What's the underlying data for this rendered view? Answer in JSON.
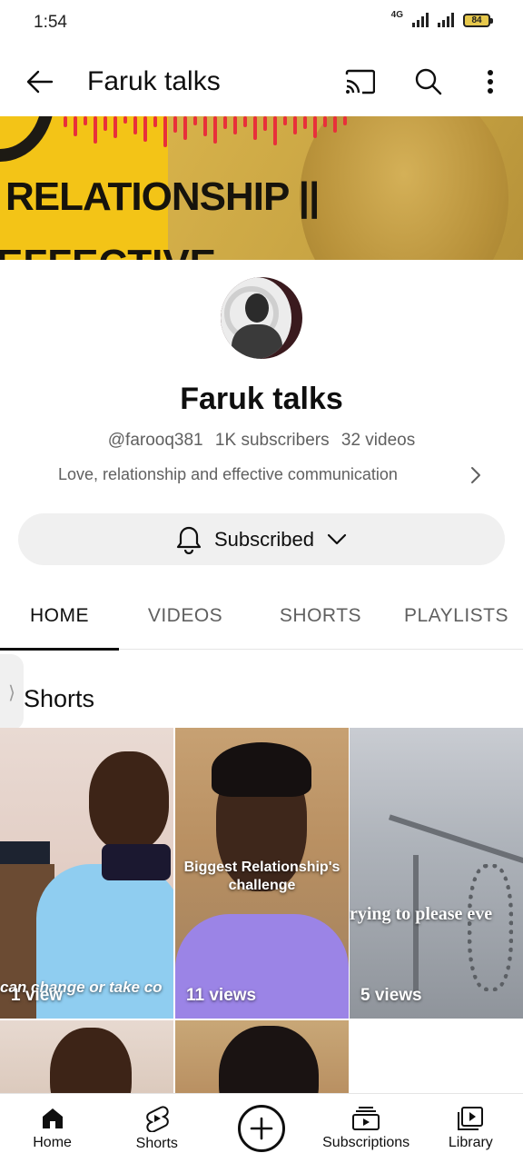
{
  "status_bar": {
    "time": "1:54",
    "network": "4G",
    "battery": "84"
  },
  "app_bar": {
    "title": "Faruk talks",
    "icons": [
      "back-arrow-icon",
      "cast-icon",
      "search-icon",
      "more-vert-icon"
    ]
  },
  "banner": {
    "headline": "RELATIONSHIP ||",
    "subline": "EFFECTIVE",
    "colors": {
      "left": "#f3c417",
      "right": "#c9a544",
      "wave": "#e8303a"
    }
  },
  "channel": {
    "name": "Faruk talks",
    "handle": "@farooq381",
    "subscribers": "1K subscribers",
    "videos": "32 videos",
    "description": "Love, relationship and effective communication"
  },
  "subscribe": {
    "label": "Subscribed",
    "icons": [
      "bell-icon",
      "chevron-down-icon"
    ]
  },
  "tabs": [
    {
      "label": "HOME",
      "active": true
    },
    {
      "label": "VIDEOS",
      "active": false
    },
    {
      "label": "SHORTS",
      "active": false
    },
    {
      "label": "PLAYLISTS",
      "active": false
    }
  ],
  "shorts_section": {
    "title": "Shorts",
    "items": [
      {
        "caption": "can change or take co",
        "views": "1 view"
      },
      {
        "caption": "Biggest Relationship's challenge",
        "views": "11 views"
      },
      {
        "caption": "rying to please eve",
        "views": "5 views"
      }
    ]
  },
  "bottom_nav": [
    {
      "label": "Home",
      "icon": "home-icon"
    },
    {
      "label": "Shorts",
      "icon": "shorts-icon"
    },
    {
      "label": "",
      "icon": "create-plus-icon"
    },
    {
      "label": "Subscriptions",
      "icon": "subscriptions-icon"
    },
    {
      "label": "Library",
      "icon": "library-icon"
    }
  ]
}
